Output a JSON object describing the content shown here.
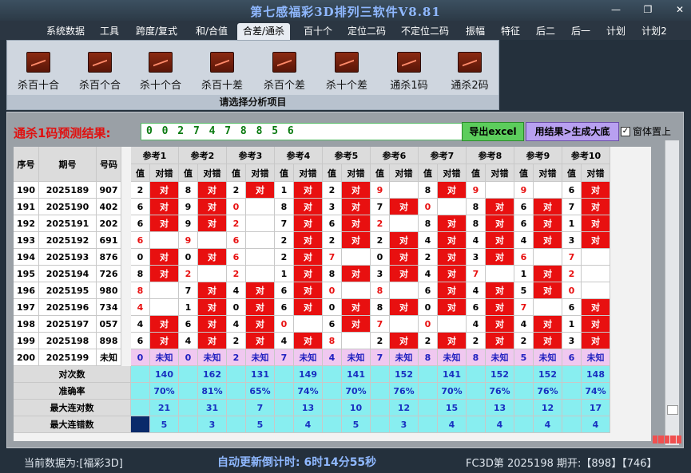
{
  "app": {
    "title": "第七感福彩3D排列三软件V8.81"
  },
  "menu": {
    "items": [
      "系统数据",
      "工具",
      "跨度/复式",
      "和/合值",
      "合差/通杀",
      "百十个",
      "定位二码",
      "不定位二码",
      "振幅",
      "特征",
      "后二",
      "后一",
      "计划",
      "计划2"
    ],
    "active": 4
  },
  "ribbon": {
    "buttons": [
      "杀百十合",
      "杀百个合",
      "杀十个合",
      "杀百十差",
      "杀百个差",
      "杀十个差",
      "通杀1码",
      "通杀2码"
    ],
    "footer": "请选择分析项目"
  },
  "prediction": {
    "label": "通杀1码预测结果:",
    "value": "0 0 2 7 4 7 8 8 5 6",
    "export_label": "导出excel",
    "generate_label": "用结果>生成大底",
    "pin_label": "窗体置上",
    "pin_checked": "✓"
  },
  "table": {
    "headers": {
      "seq": "序号",
      "period": "期号",
      "number": "号码",
      "refs": [
        "参考1",
        "参考2",
        "参考3",
        "参考4",
        "参考5",
        "参考6",
        "参考7",
        "参考8",
        "参考9",
        "参考10"
      ],
      "val": "值",
      "hit": "对错"
    },
    "hit_text": "对",
    "unknown": "未知",
    "rows": [
      {
        "seq": "190",
        "period": "2025189",
        "number": "907",
        "refs": [
          [
            "2",
            1
          ],
          [
            "8",
            1
          ],
          [
            "2",
            1
          ],
          [
            "1",
            1
          ],
          [
            "2",
            1
          ],
          [
            "9",
            0
          ],
          [
            "8",
            1
          ],
          [
            "9",
            0
          ],
          [
            "9",
            0
          ],
          [
            "6",
            1
          ]
        ]
      },
      {
        "seq": "191",
        "period": "2025190",
        "number": "402",
        "refs": [
          [
            "6",
            1
          ],
          [
            "9",
            1
          ],
          [
            "0",
            0
          ],
          [
            "8",
            1
          ],
          [
            "3",
            1
          ],
          [
            "7",
            1
          ],
          [
            "0",
            0
          ],
          [
            "8",
            1
          ],
          [
            "6",
            1
          ],
          [
            "7",
            1
          ]
        ]
      },
      {
        "seq": "192",
        "period": "2025191",
        "number": "202",
        "refs": [
          [
            "6",
            1
          ],
          [
            "9",
            1
          ],
          [
            "2",
            0
          ],
          [
            "7",
            1
          ],
          [
            "6",
            1
          ],
          [
            "2",
            0
          ],
          [
            "8",
            1
          ],
          [
            "8",
            1
          ],
          [
            "6",
            1
          ],
          [
            "1",
            1
          ]
        ]
      },
      {
        "seq": "193",
        "period": "2025192",
        "number": "691",
        "refs": [
          [
            "6",
            0
          ],
          [
            "9",
            0
          ],
          [
            "6",
            0
          ],
          [
            "2",
            1
          ],
          [
            "2",
            1
          ],
          [
            "2",
            1
          ],
          [
            "4",
            1
          ],
          [
            "4",
            1
          ],
          [
            "4",
            1
          ],
          [
            "3",
            1
          ]
        ]
      },
      {
        "seq": "194",
        "period": "2025193",
        "number": "876",
        "refs": [
          [
            "0",
            1
          ],
          [
            "0",
            1
          ],
          [
            "6",
            0
          ],
          [
            "2",
            1
          ],
          [
            "7",
            0
          ],
          [
            "0",
            1
          ],
          [
            "2",
            1
          ],
          [
            "3",
            1
          ],
          [
            "6",
            0
          ],
          [
            "7",
            0
          ]
        ]
      },
      {
        "seq": "195",
        "period": "2025194",
        "number": "726",
        "refs": [
          [
            "8",
            1
          ],
          [
            "2",
            0
          ],
          [
            "2",
            0
          ],
          [
            "1",
            1
          ],
          [
            "8",
            1
          ],
          [
            "3",
            1
          ],
          [
            "4",
            1
          ],
          [
            "7",
            0
          ],
          [
            "1",
            1
          ],
          [
            "2",
            0
          ]
        ]
      },
      {
        "seq": "196",
        "period": "2025195",
        "number": "980",
        "refs": [
          [
            "8",
            0
          ],
          [
            "7",
            1
          ],
          [
            "4",
            1
          ],
          [
            "6",
            1
          ],
          [
            "0",
            0
          ],
          [
            "8",
            0
          ],
          [
            "6",
            1
          ],
          [
            "4",
            1
          ],
          [
            "5",
            1
          ],
          [
            "0",
            0
          ]
        ]
      },
      {
        "seq": "197",
        "period": "2025196",
        "number": "734",
        "refs": [
          [
            "4",
            0
          ],
          [
            "1",
            1
          ],
          [
            "0",
            1
          ],
          [
            "6",
            1
          ],
          [
            "0",
            1
          ],
          [
            "8",
            1
          ],
          [
            "0",
            1
          ],
          [
            "6",
            1
          ],
          [
            "7",
            0
          ],
          [
            "6",
            1
          ]
        ]
      },
      {
        "seq": "198",
        "period": "2025197",
        "number": "057",
        "refs": [
          [
            "4",
            1
          ],
          [
            "6",
            1
          ],
          [
            "4",
            1
          ],
          [
            "0",
            0
          ],
          [
            "6",
            1
          ],
          [
            "7",
            0
          ],
          [
            "0",
            0
          ],
          [
            "4",
            1
          ],
          [
            "4",
            1
          ],
          [
            "1",
            1
          ]
        ]
      },
      {
        "seq": "199",
        "period": "2025198",
        "number": "898",
        "refs": [
          [
            "6",
            1
          ],
          [
            "4",
            1
          ],
          [
            "2",
            1
          ],
          [
            "4",
            1
          ],
          [
            "8",
            0
          ],
          [
            "2",
            1
          ],
          [
            "2",
            1
          ],
          [
            "2",
            1
          ],
          [
            "2",
            1
          ],
          [
            "3",
            1
          ]
        ]
      }
    ],
    "pending": {
      "seq": "200",
      "period": "2025199",
      "number": "未知",
      "values": [
        "0",
        "0",
        "2",
        "7",
        "4",
        "7",
        "8",
        "8",
        "5",
        "6"
      ]
    },
    "stats": [
      {
        "label": "对次数",
        "values": [
          "140",
          "162",
          "131",
          "149",
          "141",
          "152",
          "141",
          "152",
          "152",
          "148"
        ]
      },
      {
        "label": "准确率",
        "values": [
          "70%",
          "81%",
          "65%",
          "74%",
          "70%",
          "76%",
          "70%",
          "76%",
          "76%",
          "74%"
        ]
      },
      {
        "label": "最大连对数",
        "values": [
          "21",
          "31",
          "7",
          "13",
          "10",
          "12",
          "15",
          "13",
          "12",
          "17"
        ]
      },
      {
        "label": "最大连错数",
        "values": [
          "5",
          "3",
          "5",
          "4",
          "5",
          "3",
          "4",
          "4",
          "4",
          "4"
        ]
      }
    ]
  },
  "status": {
    "left": "当前数据为:[福彩3D]",
    "countdown": "自动更新倒计时: 6时14分55秒",
    "right": "FC3D第 2025198 期开:【898】【746】"
  },
  "colors": {
    "hit": "#e81010",
    "pending": "#f0c8f0",
    "stats_bg": "#88eef0",
    "header_bg": "#dcdcdc"
  }
}
